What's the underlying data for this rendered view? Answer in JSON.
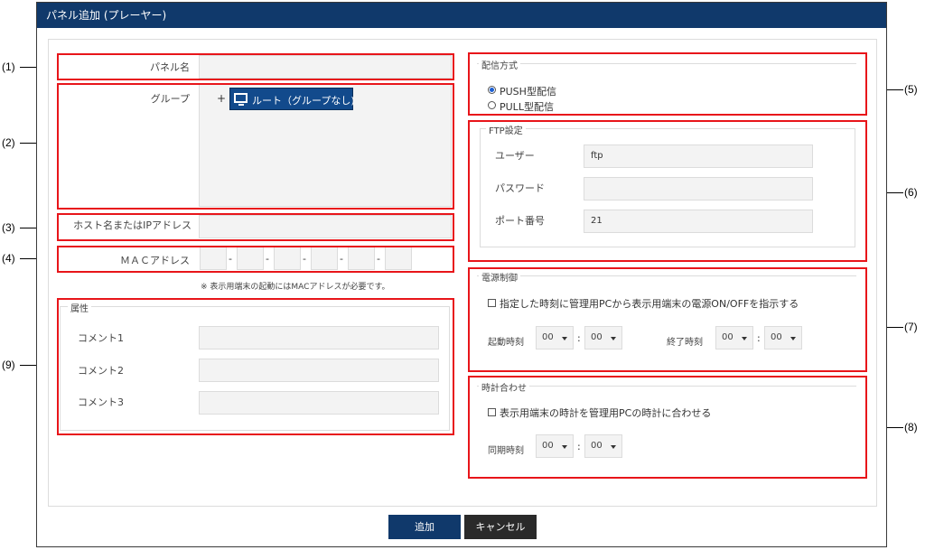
{
  "window": {
    "title": "パネル追加 (プレーヤー)"
  },
  "callouts": {
    "c1": "(1)",
    "c2": "(2)",
    "c3": "(3)",
    "c4": "(4)",
    "c5": "(5)",
    "c6": "(6)",
    "c7": "(7)",
    "c8": "(8)",
    "c9": "(9)"
  },
  "panel_name": {
    "label": "パネル名",
    "value": ""
  },
  "group": {
    "label": "グループ",
    "expander": "+",
    "root_node": "ルート（グループなし)"
  },
  "host": {
    "label": "ホスト名またはIPアドレス",
    "value": ""
  },
  "mac": {
    "label": "ＭＡＣアドレス",
    "separator": "-",
    "note": "※ 表示用端末の起動にはMACアドレスが必要です。"
  },
  "attributes": {
    "legend": "属性",
    "items": [
      {
        "label": "コメント1",
        "value": ""
      },
      {
        "label": "コメント2",
        "value": ""
      },
      {
        "label": "コメント3",
        "value": ""
      }
    ]
  },
  "delivery": {
    "legend": "配信方式",
    "options": [
      {
        "label": "PUSH型配信",
        "checked": true
      },
      {
        "label": "PULL型配信",
        "checked": false
      }
    ]
  },
  "ftp": {
    "legend": "FTP設定",
    "user": {
      "label": "ユーザー",
      "value": "ftp"
    },
    "password": {
      "label": "パスワード",
      "value": ""
    },
    "port": {
      "label": "ポート番号",
      "value": "21"
    }
  },
  "power": {
    "legend": "電源制御",
    "checkbox_label": "指定した時刻に管理用PCから表示用端末の電源ON/OFFを指示する",
    "start_label": "起動時刻",
    "end_label": "終了時刻",
    "start_hour": "00",
    "start_min": "00",
    "end_hour": "00",
    "end_min": "00",
    "colon": ":"
  },
  "clock": {
    "legend": "時計合わせ",
    "checkbox_label": "表示用端末の時計を管理用PCの時計に合わせる",
    "sync_label": "同期時刻",
    "hour": "00",
    "min": "00",
    "colon": ":"
  },
  "buttons": {
    "add": "追加",
    "cancel": "キャンセル"
  },
  "colors": {
    "titlebar": "#10396b",
    "primary_button": "#10396b",
    "secondary_button": "#2a2a2a",
    "callout_box": "#e8151a",
    "tree_node": "#124a8c"
  }
}
